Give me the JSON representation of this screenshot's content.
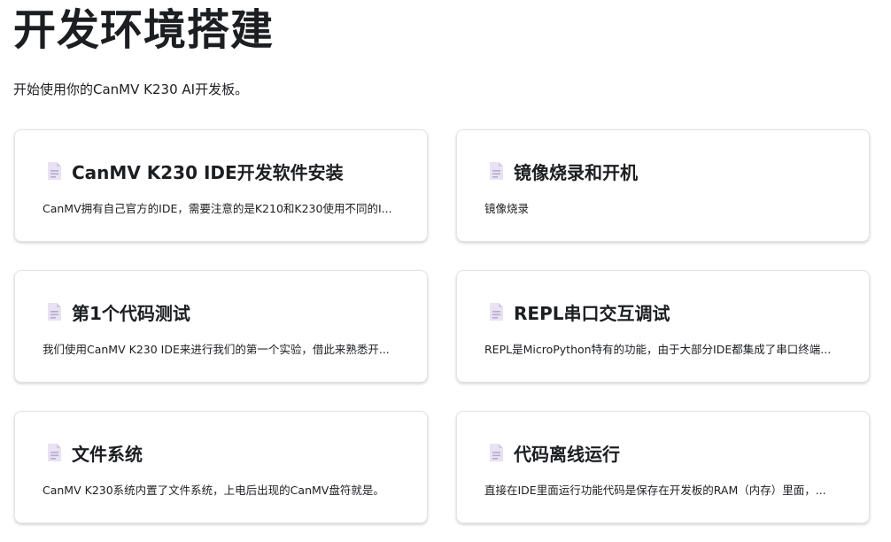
{
  "header": {
    "title": "开发环境搭建",
    "subtitle": "开始使用你的CanMV K230 AI开发板。"
  },
  "cards": [
    {
      "icon": "document-icon",
      "title": "CanMV K230 IDE开发软件安装",
      "description": "CanMV拥有自己官方的IDE，需要注意的是K210和K230使用不同的I..."
    },
    {
      "icon": "document-icon",
      "title": "镜像烧录和开机",
      "description": "镜像烧录"
    },
    {
      "icon": "document-icon",
      "title": "第1个代码测试",
      "description": "我们使用CanMV K230 IDE来进行我们的第一个实验，借此来熟悉开..."
    },
    {
      "icon": "document-icon",
      "title": "REPL串口交互调试",
      "description": "REPL是MicroPython特有的功能，由于大部分IDE都集成了串口终端..."
    },
    {
      "icon": "document-icon",
      "title": "文件系统",
      "description": "CanMV K230系统内置了文件系统，上电后出现的CanMV盘符就是。"
    },
    {
      "icon": "document-icon",
      "title": "代码离线运行",
      "description": "直接在IDE里面运行功能代码是保存在开发板的RAM（内存）里面，..."
    }
  ],
  "colors": {
    "text": "#1c1e21",
    "card_border": "#e4e4e7",
    "icon_fill": "#e8e2f3",
    "icon_line": "#b7aad0"
  }
}
